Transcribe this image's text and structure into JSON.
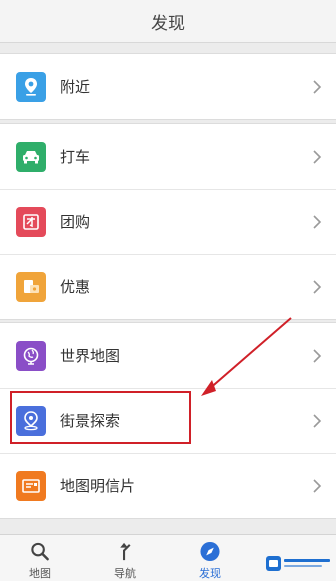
{
  "header": {
    "title": "发现"
  },
  "groups": [
    {
      "items": [
        {
          "label": "附近",
          "icon": "location-pin-icon",
          "color": "#3aa0e6"
        }
      ]
    },
    {
      "items": [
        {
          "label": "打车",
          "icon": "car-icon",
          "color": "#2fae6a"
        },
        {
          "label": "团购",
          "icon": "group-buy-icon",
          "color": "#e44a5a"
        },
        {
          "label": "优惠",
          "icon": "coupon-icon",
          "color": "#f0a43a"
        }
      ]
    },
    {
      "items": [
        {
          "label": "世界地图",
          "icon": "globe-icon",
          "color": "#8a4ec7"
        },
        {
          "label": "街景探索",
          "icon": "street-view-icon",
          "color": "#4a6fdc"
        },
        {
          "label": "地图明信片",
          "icon": "postcard-icon",
          "color": "#f07a20"
        }
      ]
    }
  ],
  "tabs": [
    {
      "label": "地图",
      "icon": "search-icon",
      "active": false
    },
    {
      "label": "导航",
      "icon": "navigation-icon",
      "active": false
    },
    {
      "label": "发现",
      "icon": "compass-icon",
      "active": true
    }
  ],
  "annotation": {
    "color": "#d02028",
    "highlighted_item": "街景探索"
  },
  "colors": {
    "active_tab": "#2b6fd6",
    "background": "#ececec"
  }
}
